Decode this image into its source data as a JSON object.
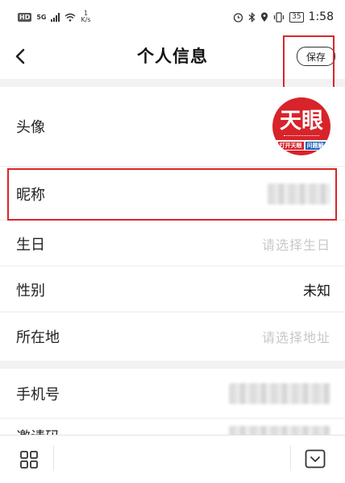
{
  "status_bar": {
    "hd_badge": "HD",
    "network": "5G",
    "speed_value": "1",
    "speed_unit": "K/s",
    "battery": "35",
    "time": "1:58"
  },
  "header": {
    "title": "个人信息",
    "save_label": "保存",
    "back_icon": "chevron-left-icon"
  },
  "avatar": {
    "label": "头像",
    "logo_text": "天眼",
    "logo_band_left": "打开天眼",
    "logo_band_right": "问题解",
    "logo_color": "#d8232a"
  },
  "fields": {
    "nickname": {
      "label": "昵称"
    },
    "birthday": {
      "label": "生日",
      "placeholder": "请选择生日"
    },
    "gender": {
      "label": "性别",
      "value": "未知"
    },
    "location": {
      "label": "所在地",
      "placeholder": "请选择地址"
    },
    "phone": {
      "label": "手机号"
    },
    "invite_code": {
      "label": "邀请码"
    }
  },
  "bottom_bar": {
    "menu_icon": "grid-icon",
    "collapse_icon": "chevron-down-icon"
  },
  "colors": {
    "highlight": "#d9252a",
    "placeholder": "#c8c8c8",
    "background": "#f2f2f2"
  }
}
